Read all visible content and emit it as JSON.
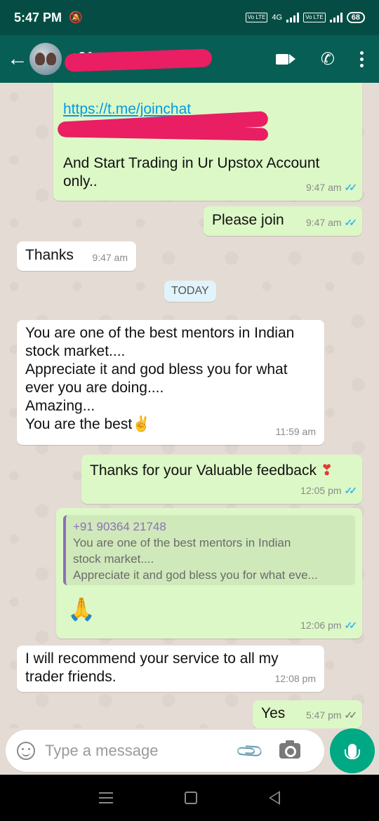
{
  "status_bar": {
    "time": "5:47 PM",
    "network_badge_1": "Vo LTE",
    "network_type": "4G",
    "network_badge_2": "Vo LTE",
    "battery": "68"
  },
  "header": {
    "contact_name_visible": "+91",
    "icons": [
      "back-arrow-icon",
      "video-call-icon",
      "voice-call-icon",
      "more-options-icon"
    ]
  },
  "messages": [
    {
      "direction": "out",
      "link": "https://t.me/joinchat",
      "text": "And Start Trading in Ur Upstox Account only..",
      "time": "9:47 am",
      "status": "read"
    },
    {
      "direction": "out",
      "text": "Please join",
      "time": "9:47 am",
      "status": "read"
    },
    {
      "direction": "in",
      "text": "Thanks",
      "time": "9:47 am"
    },
    {
      "direction": "in",
      "text_lines": [
        "You are one of the best mentors in Indian",
        "stock market....",
        "Appreciate it and god bless you for what",
        "ever you are doing....",
        "Amazing...",
        "You are the best"
      ],
      "emoji": "✌",
      "time": "11:59 am"
    },
    {
      "direction": "out",
      "text": "Thanks for your Valuable feedback",
      "emoji": "❣",
      "time": "12:05 pm",
      "status": "read"
    },
    {
      "direction": "out",
      "quote_name": "+91 90364 21748",
      "quote_lines": [
        "You are one of the best mentors in Indian",
        "stock market....",
        "Appreciate it and god bless you for what eve..."
      ],
      "emoji": "🙏",
      "time": "12:06 pm",
      "status": "read"
    },
    {
      "direction": "in",
      "text_lines": [
        "I will recommend your service to all my",
        "trader friends."
      ],
      "time": "12:08 pm"
    },
    {
      "direction": "out",
      "text": "Yes",
      "time": "5:47 pm",
      "status": "sent"
    }
  ],
  "date_divider": "TODAY",
  "composer": {
    "placeholder": "Type a message"
  },
  "colors": {
    "header": "#075e54",
    "status_bar": "#054d44",
    "outgoing_bubble": "#dcf8c6",
    "incoming_bubble": "#ffffff",
    "read_ticks": "#34b7f1",
    "mic_button": "#00a884",
    "redaction": "#e91e63"
  }
}
